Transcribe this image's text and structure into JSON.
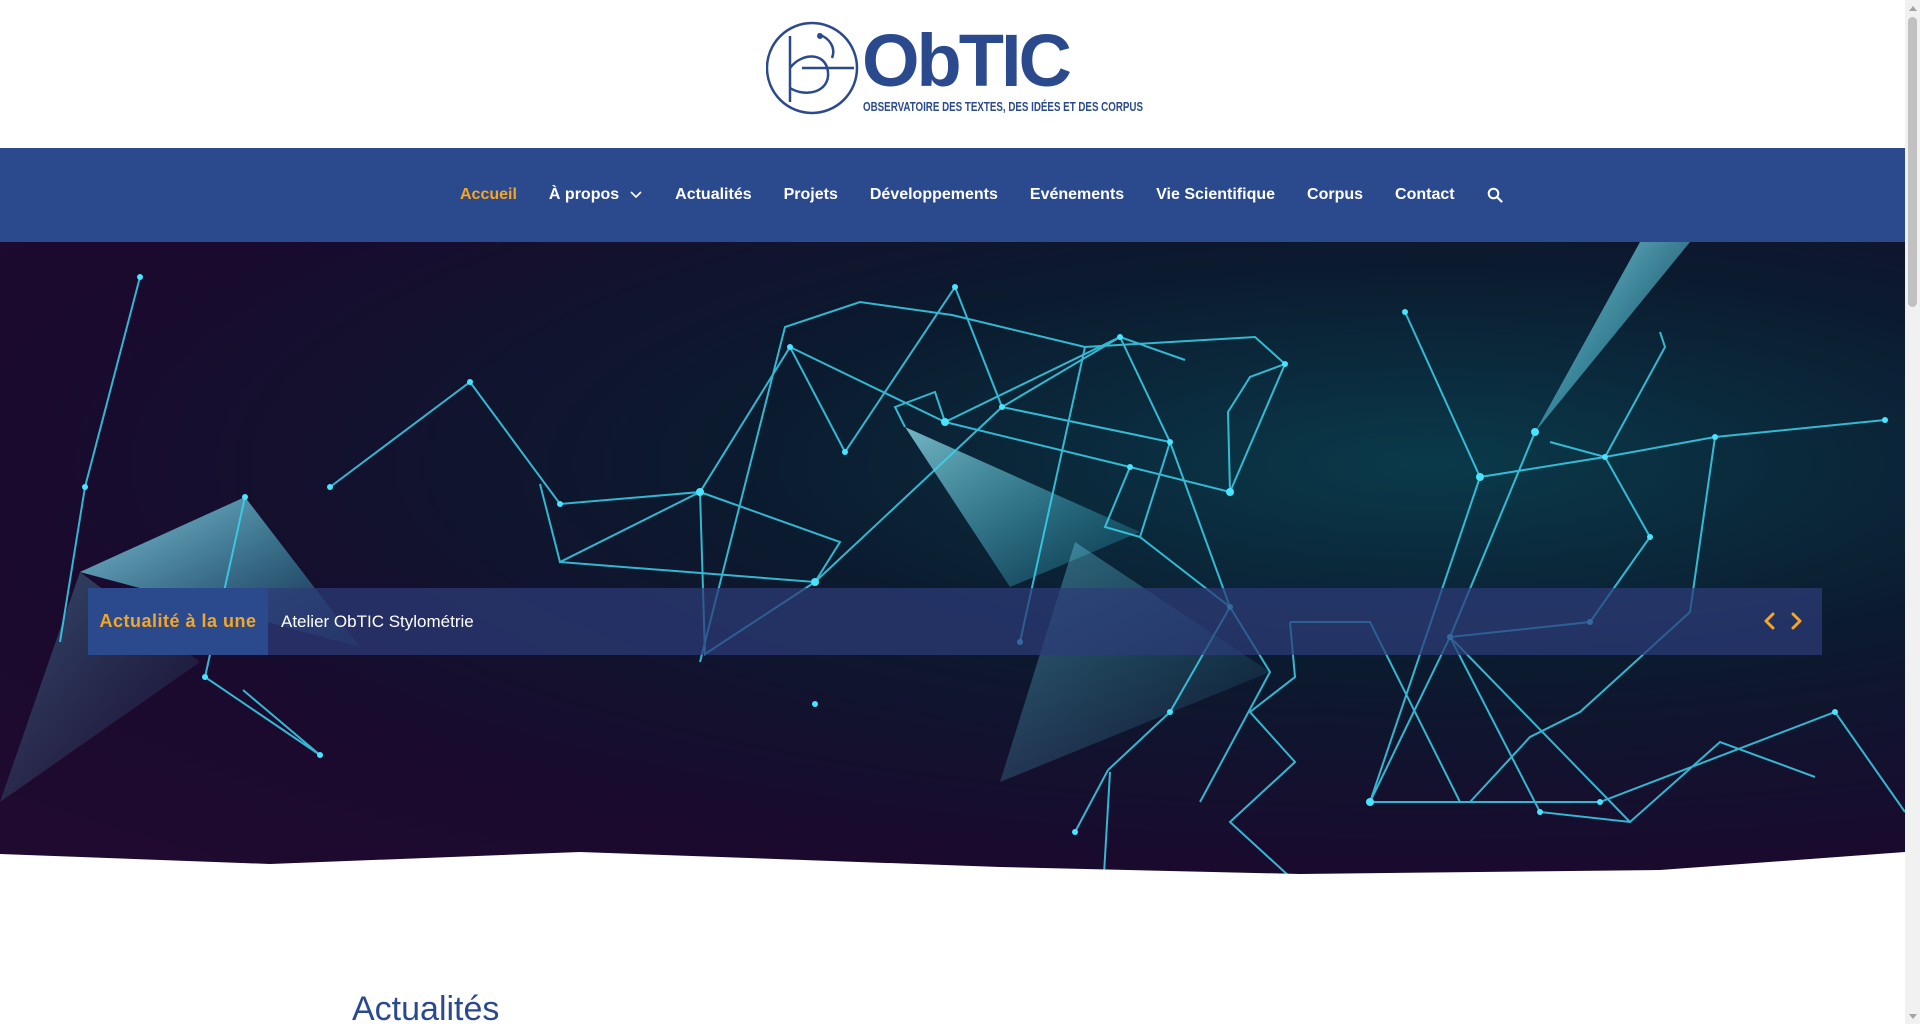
{
  "header": {
    "logo_title": "ObTIC",
    "logo_subtitle": "OBSERVATOIRE DES TEXTES, DES IDÉES ET DES CORPUS"
  },
  "nav": {
    "items": [
      {
        "label": "Accueil",
        "active": true
      },
      {
        "label": "À propos",
        "has_dropdown": true
      },
      {
        "label": "Actualités"
      },
      {
        "label": "Projets"
      },
      {
        "label": "Développements"
      },
      {
        "label": "Evénements"
      },
      {
        "label": "Vie Scientifique"
      },
      {
        "label": "Corpus"
      },
      {
        "label": "Contact"
      }
    ],
    "search_icon": "search-icon"
  },
  "ticker": {
    "label": "Actualité à la une",
    "headline": "Atelier ObTIC Stylométrie",
    "prev_icon": "chevron-left-icon",
    "next_icon": "chevron-right-icon"
  },
  "main": {
    "section_title": "Actualités"
  },
  "colors": {
    "brand_blue": "#2b4a8e",
    "accent_orange": "#f5a623",
    "hero_cyan": "#33d6f0"
  }
}
